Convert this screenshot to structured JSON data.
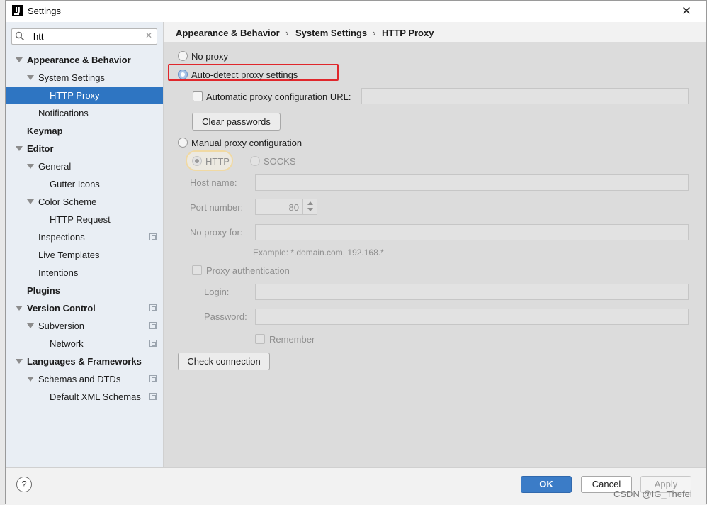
{
  "window": {
    "title": "Settings",
    "app_icon": "intellij-icon",
    "close_icon": "close-icon"
  },
  "search": {
    "value": "htt",
    "icon": "search-icon",
    "clear_icon": "clear-icon"
  },
  "tree": [
    {
      "label": "Appearance & Behavior",
      "bold": true,
      "expanded": true
    },
    {
      "label": "System Settings",
      "expanded": true
    },
    {
      "label": "HTTP Proxy",
      "selected": true
    },
    {
      "label": "Notifications"
    },
    {
      "label": "Keymap",
      "bold": true
    },
    {
      "label": "Editor",
      "bold": true,
      "expanded": true
    },
    {
      "label": "General",
      "expanded": true
    },
    {
      "label": "Gutter Icons"
    },
    {
      "label": "Color Scheme",
      "expanded": true
    },
    {
      "label": "HTTP Request"
    },
    {
      "label": "Inspections",
      "project_icon": true
    },
    {
      "label": "Live Templates"
    },
    {
      "label": "Intentions"
    },
    {
      "label": "Plugins",
      "bold": true
    },
    {
      "label": "Version Control",
      "bold": true,
      "expanded": true,
      "project_icon": true
    },
    {
      "label": "Subversion",
      "expanded": true,
      "project_icon": true
    },
    {
      "label": "Network",
      "project_icon": true
    },
    {
      "label": "Languages & Frameworks",
      "bold": true,
      "expanded": true
    },
    {
      "label": "Schemas and DTDs",
      "expanded": true,
      "project_icon": true
    },
    {
      "label": "Default XML Schemas",
      "project_icon": true
    }
  ],
  "breadcrumb": {
    "part1": "Appearance & Behavior",
    "part2": "System Settings",
    "part3": "HTTP Proxy",
    "separator": "›"
  },
  "proxy": {
    "no_proxy": "No proxy",
    "auto_detect": "Auto-detect proxy settings",
    "auto_config_url_label": "Automatic proxy configuration URL:",
    "auto_config_url_value": "",
    "clear_passwords": "Clear passwords",
    "manual": "Manual proxy configuration",
    "http": "HTTP",
    "socks": "SOCKS",
    "host_name_label": "Host name:",
    "host_name_value": "",
    "port_label": "Port number:",
    "port_value": "80",
    "no_proxy_for_label": "No proxy for:",
    "no_proxy_for_value": "",
    "example": "Example: *.domain.com, 192.168.*",
    "proxy_auth": "Proxy authentication",
    "login_label": "Login:",
    "login_value": "",
    "password_label": "Password:",
    "password_value": "",
    "remember": "Remember",
    "check_connection": "Check connection",
    "selected_option": "auto-detect"
  },
  "footer": {
    "help": "?",
    "ok": "OK",
    "cancel": "Cancel",
    "apply": "Apply",
    "watermark": "CSDN @IG_Thefei"
  },
  "colors": {
    "selection": "#2e75c2",
    "ok_button": "#3b7cc7",
    "highlight_box": "#e0272c",
    "tree_bg": "#e9eef4",
    "panel_bg": "#dcdcdc"
  }
}
